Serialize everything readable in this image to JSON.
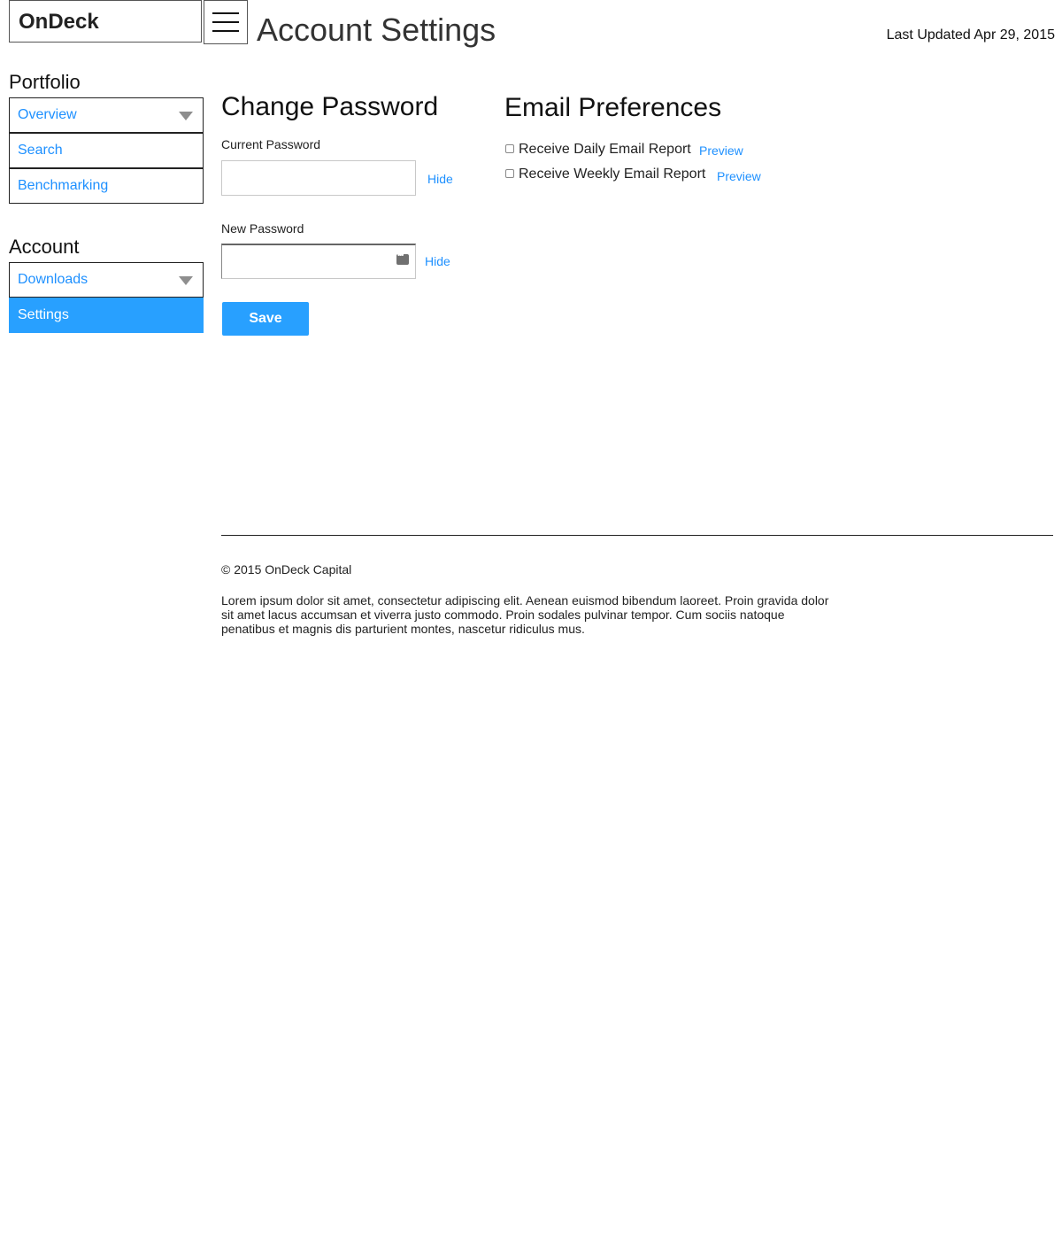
{
  "header": {
    "brand": "OnDeck",
    "title": "Account Settings",
    "last_updated": "Last Updated Apr 29, 2015",
    "menu_icon": "hamburger-icon"
  },
  "sidebar": {
    "portfolio_heading": "Portfolio",
    "portfolio_items": [
      {
        "label": "Overview",
        "expandable": true
      },
      {
        "label": "Search"
      },
      {
        "label": "Benchmarking"
      }
    ],
    "account_heading": "Account",
    "account_items": [
      {
        "label": "Downloads",
        "expandable": true
      },
      {
        "label": "Settings",
        "active": true
      }
    ]
  },
  "change_password": {
    "title": "Change Password",
    "current_label": "Current Password",
    "current_value": "",
    "current_toggle": "Hide",
    "new_label": "New Password",
    "new_value": "",
    "new_toggle": "Hide",
    "save_label": "Save"
  },
  "email_preferences": {
    "title": "Email Preferences",
    "options": [
      {
        "label": "Receive Daily Email Report",
        "checked": false,
        "link": "Preview"
      },
      {
        "label": "Receive Weekly Email Report",
        "checked": false,
        "link": "Preview"
      }
    ]
  },
  "footer": {
    "copyright": "© 2015 OnDeck Capital",
    "text": "Lorem ipsum dolor sit amet, consectetur adipiscing elit. Aenean euismod bibendum laoreet. Proin gravida dolor sit amet lacus accumsan et viverra justo commodo. Proin sodales pulvinar tempor. Cum sociis natoque penatibus et magnis dis parturient montes, nascetur ridiculus mus."
  },
  "colors": {
    "accent": "#28a0ff",
    "link": "#1e90ff"
  }
}
